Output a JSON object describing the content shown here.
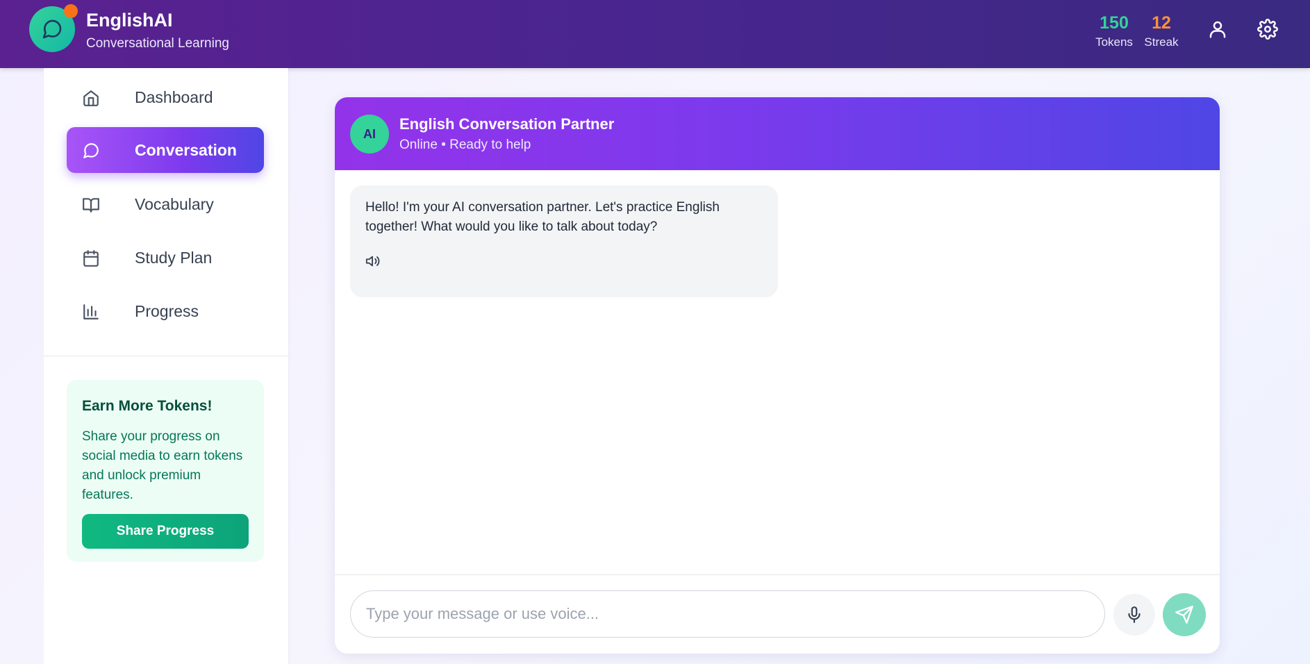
{
  "header": {
    "brand_title": "EnglishAI",
    "brand_subtitle": "Conversational Learning",
    "tokens_value": "150",
    "tokens_label": "Tokens",
    "streak_value": "12",
    "streak_label": "Streak",
    "user_icon": "user-icon",
    "settings_icon": "gear-icon",
    "notification_dot_color": "#f97316"
  },
  "sidebar": {
    "items": [
      {
        "label": "Dashboard",
        "icon": "home-icon",
        "active": false
      },
      {
        "label": "Conversation",
        "icon": "chat-bubble-icon",
        "active": true
      },
      {
        "label": "Vocabulary",
        "icon": "book-icon",
        "active": false
      },
      {
        "label": "Study Plan",
        "icon": "calendar-icon",
        "active": false
      },
      {
        "label": "Progress",
        "icon": "bar-chart-icon",
        "active": false
      }
    ],
    "promo": {
      "title": "Earn More Tokens!",
      "text": "Share your progress on social media to earn tokens and unlock premium features.",
      "button_label": "Share Progress"
    }
  },
  "chat": {
    "avatar_text": "AI",
    "title": "English Conversation Partner",
    "status": "Online • Ready to help",
    "messages": [
      {
        "sender": "ai",
        "text": "Hello! I'm your AI conversation partner. Let's practice English together! What would you like to talk about today?",
        "icon": "speaker-icon"
      }
    ],
    "input_placeholder": "Type your message or use voice...",
    "input_value": "",
    "mic_icon": "microphone-icon",
    "send_icon": "send-icon"
  },
  "colors": {
    "header_gradient": [
      "#5b2190",
      "#3a2a80"
    ],
    "accent_purple": "#7c3aed",
    "accent_green": "#10b981",
    "tokens_color": "#34d399",
    "streak_color": "#fb923c"
  }
}
